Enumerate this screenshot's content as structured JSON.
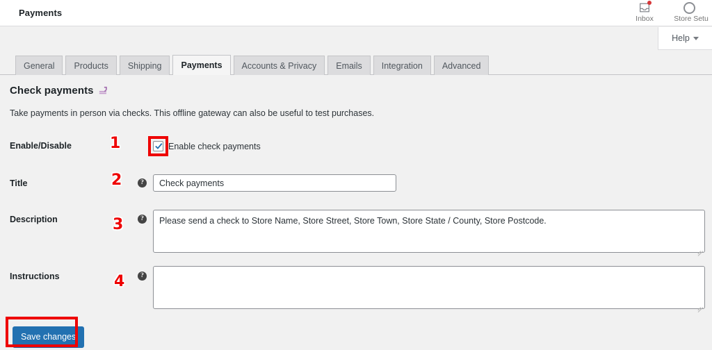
{
  "header": {
    "page_title": "Payments",
    "inbox_label": "Inbox",
    "store_setup_label": "Store Setu",
    "help_label": "Help",
    "inbox_icon": "inbox-tray-icon",
    "notification_dot_color": "#d63638",
    "store_setup_icon": "progress-ring-icon",
    "caret_icon": "chevron-down-icon"
  },
  "tabs": [
    {
      "label": "General",
      "active": false
    },
    {
      "label": "Products",
      "active": false
    },
    {
      "label": "Shipping",
      "active": false
    },
    {
      "label": "Payments",
      "active": true
    },
    {
      "label": "Accounts & Privacy",
      "active": false
    },
    {
      "label": "Emails",
      "active": false
    },
    {
      "label": "Integration",
      "active": false
    },
    {
      "label": "Advanced",
      "active": false
    }
  ],
  "section": {
    "heading": "Check payments",
    "back_icon": "return-arrow-icon",
    "description": "Take payments in person via checks. This offline gateway can also be useful to test purchases."
  },
  "fields": {
    "enable": {
      "label": "Enable/Disable",
      "checkbox_label": "Enable check payments",
      "checked": true,
      "step": "1"
    },
    "title": {
      "label": "Title",
      "value": "Check payments",
      "help_glyph": "?",
      "step": "2"
    },
    "description": {
      "label": "Description",
      "value": "Please send a check to Store Name, Store Street, Store Town, Store State / County, Store Postcode.",
      "help_glyph": "?",
      "step": "3"
    },
    "instructions": {
      "label": "Instructions",
      "value": "",
      "help_glyph": "?",
      "step": "4"
    }
  },
  "footer": {
    "save_label": "Save changes"
  },
  "colors": {
    "accent_blue": "#2271b1",
    "annotation_red": "#ee0000",
    "body_bg": "#f1f1f1",
    "header_bg": "#ffffff",
    "tab_inactive_bg": "#dcdcde",
    "back_icon_purple": "#a572b1"
  }
}
